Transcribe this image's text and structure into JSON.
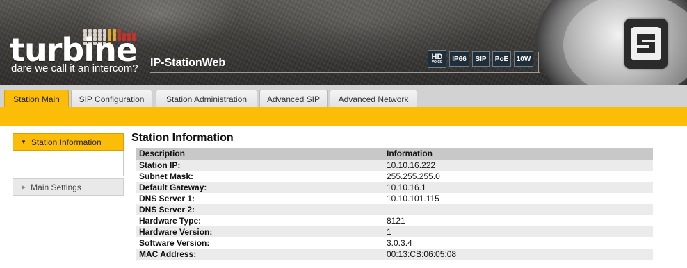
{
  "brand": {
    "wordmark": "turbine",
    "tagline": "dare we call it an intercom?",
    "app_title": "IP-StationWeb",
    "colors": {
      "accent": "#fbbd08",
      "badge_bg": "#1e2f3b"
    }
  },
  "badges": [
    {
      "label": "HD",
      "sub": "VOICE"
    },
    {
      "label": "IP66"
    },
    {
      "label": "SIP"
    },
    {
      "label": "PoE"
    },
    {
      "label": "10W"
    }
  ],
  "tabs": [
    {
      "label": "Station Main",
      "active": true
    },
    {
      "label": "SIP Configuration",
      "active": false
    },
    {
      "label": "Station Administration",
      "active": false
    },
    {
      "label": "Advanced SIP",
      "active": false
    },
    {
      "label": "Advanced Network",
      "active": false
    }
  ],
  "sidebar": {
    "active_label": "Station Information",
    "items": [
      {
        "label": "Main Settings"
      }
    ]
  },
  "main": {
    "title": "Station Information",
    "columns": [
      "Description",
      "Information"
    ],
    "rows": [
      {
        "desc": "Station IP:",
        "value": "10.10.16.222"
      },
      {
        "desc": "Subnet Mask:",
        "value": "255.255.255.0"
      },
      {
        "desc": "Default Gateway:",
        "value": "10.10.16.1"
      },
      {
        "desc": "DNS Server 1:",
        "value": "10.10.101.115"
      },
      {
        "desc": "DNS Server 2:",
        "value": ""
      },
      {
        "desc": "Hardware Type:",
        "value": "8121"
      },
      {
        "desc": "Hardware Version:",
        "value": "1"
      },
      {
        "desc": "Software Version:",
        "value": "3.0.3.4"
      },
      {
        "desc": "MAC Address:",
        "value": "00:13:CB:06:05:08"
      }
    ]
  }
}
